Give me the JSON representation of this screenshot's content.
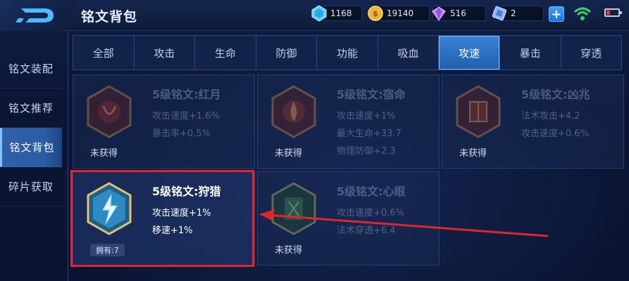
{
  "header": {
    "title": "铭文背包",
    "resources": [
      {
        "name": "diamond",
        "value": "1168",
        "icon": "diamond-icon"
      },
      {
        "name": "gold",
        "value": "19140",
        "icon": "gold-coin-icon"
      },
      {
        "name": "gem",
        "value": "516",
        "icon": "purple-gem-icon"
      },
      {
        "name": "ticket",
        "value": "2",
        "icon": "ticket-icon"
      }
    ],
    "plus_label": "+",
    "battery_color": "#e23b3b",
    "wifi_color": "#2fd26b"
  },
  "sidebar": {
    "items": [
      {
        "label": "铭文装配",
        "active": false
      },
      {
        "label": "铭文推荐",
        "active": false
      },
      {
        "label": "铭文背包",
        "active": true
      },
      {
        "label": "碎片获取",
        "active": false
      }
    ]
  },
  "tabs": [
    {
      "label": "全部",
      "active": false
    },
    {
      "label": "攻击",
      "active": false
    },
    {
      "label": "生命",
      "active": false
    },
    {
      "label": "防御",
      "active": false
    },
    {
      "label": "功能",
      "active": false
    },
    {
      "label": "吸血",
      "active": false
    },
    {
      "label": "攻速",
      "active": true
    },
    {
      "label": "暴击",
      "active": false
    },
    {
      "label": "穿透",
      "active": false
    }
  ],
  "cards": [
    {
      "name": "5级铭文:红月",
      "stats": [
        "攻击速度+1.6%",
        "暴击率+0.5%"
      ],
      "status": "未获得",
      "owned": false,
      "color": "red"
    },
    {
      "name": "5级铭文:宿命",
      "stats": [
        "攻击速度+1%",
        "最大生命+33.7",
        "物理防御+2.3"
      ],
      "status": "未获得",
      "owned": false,
      "color": "red"
    },
    {
      "name": "5级铭文:凶兆",
      "stats": [
        "法术攻击+4.2",
        "攻击速度+0.6%"
      ],
      "status": "未获得",
      "owned": false,
      "color": "red"
    },
    {
      "name": "5级铭文:狩猎",
      "stats": [
        "攻击速度+1%",
        "移速+1%"
      ],
      "status": "拥有:7",
      "owned": true,
      "color": "blue"
    },
    {
      "name": "5级铭文:心眼",
      "stats": [
        "攻击速度+0.6%",
        "法术穿透+6.4"
      ],
      "status": "未获得",
      "owned": false,
      "color": "green"
    }
  ],
  "accent_colors": {
    "active_tab": "#2f6fc4",
    "highlight_box": "#e3242b"
  }
}
